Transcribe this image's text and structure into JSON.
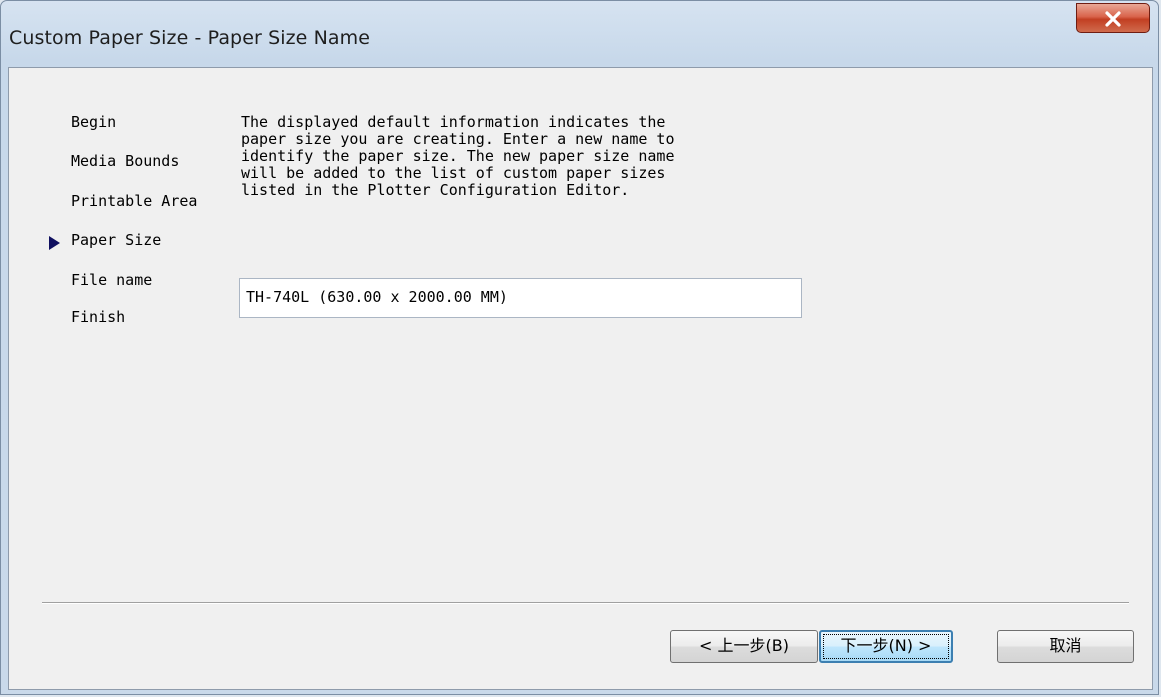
{
  "window": {
    "title": "Custom Paper Size - Paper Size Name",
    "close_label": "x"
  },
  "steps": [
    {
      "label": "Begin",
      "current": false
    },
    {
      "label": "Media Bounds",
      "current": false
    },
    {
      "label": "Printable Area",
      "current": false
    },
    {
      "label": "Paper Size",
      "current": true
    },
    {
      "label": "File name",
      "current": false
    },
    {
      "label": "Finish",
      "current": false
    }
  ],
  "description": "The displayed default information indicates the\npaper size you are creating. Enter a new name to\nidentify the paper size. The new paper size name\nwill be added to the list of custom paper sizes\nlisted in the Plotter Configuration Editor.",
  "paper_size_name": {
    "value": "TH-740L (630.00 x 2000.00 MM)"
  },
  "buttons": {
    "back_label": "< 上一步(B)",
    "next_label": "下一步(N) >",
    "cancel_label": "取消"
  },
  "colors": {
    "current_step_arrow": "#101060",
    "default_button_border": "#3c7fb1",
    "close_button": "#c23f22"
  }
}
